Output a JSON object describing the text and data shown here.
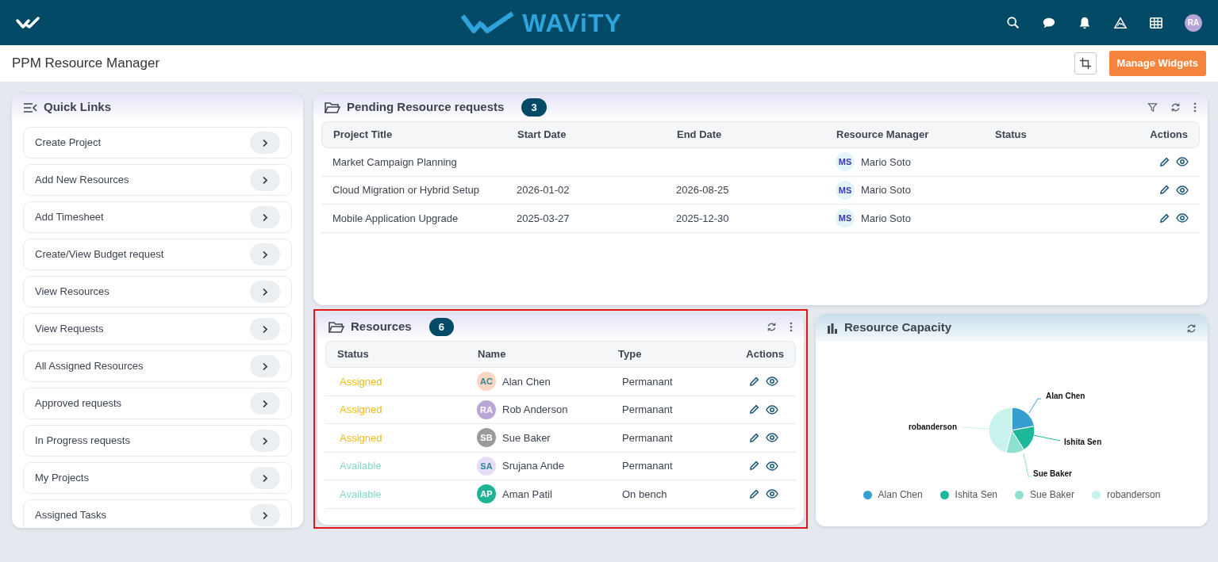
{
  "app": {
    "logo_text": "WAViTY",
    "user_initials": "RA"
  },
  "page": {
    "title": "PPM Resource Manager",
    "button": "Manage Widgets"
  },
  "quick_links": {
    "title": "Quick Links",
    "items": [
      {
        "label": "Create Project"
      },
      {
        "label": "Add New Resources"
      },
      {
        "label": "Add Timesheet"
      },
      {
        "label": "Create/View Budget request"
      },
      {
        "label": "View Resources"
      },
      {
        "label": "View Requests"
      },
      {
        "label": "All Assigned Resources"
      },
      {
        "label": "Approved requests"
      },
      {
        "label": "In Progress requests"
      },
      {
        "label": "My Projects"
      },
      {
        "label": "Assigned Tasks"
      }
    ]
  },
  "pending": {
    "title": "Pending Resource requests",
    "count": "3",
    "columns": [
      "Project Title",
      "Start Date",
      "End Date",
      "Resource Manager",
      "Status",
      "Actions"
    ],
    "rows": [
      {
        "project": "Market Campaign Planning",
        "manager": {
          "initials": "MS",
          "name": "Mario Soto"
        }
      },
      {
        "project": "Cloud Migration or Hybrid Setup",
        "start": "2026-01-02",
        "end": "2026-08-25",
        "manager": {
          "initials": "MS",
          "name": "Mario Soto"
        }
      },
      {
        "project": "Mobile Application Upgrade",
        "start": "2025-03-27",
        "end": "2025-12-30",
        "manager": {
          "initials": "MS",
          "name": "Mario Soto"
        }
      }
    ]
  },
  "resources": {
    "title": "Resources",
    "count": "6",
    "highlighted": true,
    "columns": [
      "Status",
      "Name",
      "Type",
      "Actions"
    ],
    "rows": [
      {
        "status": "Assigned",
        "kind": "assigned",
        "initials": "AC",
        "color": "#fdd5c0",
        "name": "Alan Chen",
        "type": "Permanant"
      },
      {
        "status": "Assigned",
        "kind": "assigned",
        "initials": "RA",
        "color": "#b8a6d6",
        "name": "Rob Anderson",
        "type": "Permanant"
      },
      {
        "status": "Assigned",
        "kind": "assigned",
        "initials": "SB",
        "color": "#9a9a9a",
        "name": "Sue Baker",
        "type": "Permanant"
      },
      {
        "status": "Available",
        "kind": "available",
        "initials": "SA",
        "color": "#e6def5",
        "name": "Srujana Ande",
        "type": "Permanant"
      },
      {
        "status": "Available",
        "kind": "available",
        "initials": "AP",
        "color": "#1db394",
        "name": "Aman Patil",
        "type": "On bench"
      }
    ]
  },
  "capacity": {
    "title": "Resource Capacity",
    "pie_labels": [
      "Alan Chen",
      "Ishita Sen",
      "Sue Baker",
      "robanderson"
    ],
    "legend": [
      {
        "label": "Alan Chen",
        "color": "#379fd0"
      },
      {
        "label": "Ishita Sen",
        "color": "#1db899"
      },
      {
        "label": "Sue Baker",
        "color": "#8ee0cf"
      },
      {
        "label": "robanderson",
        "color": "#c8f3ec"
      }
    ]
  }
}
